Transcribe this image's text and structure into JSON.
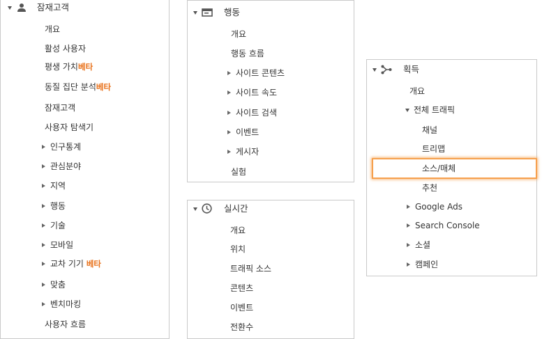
{
  "audience": {
    "title": "잠재고객",
    "icon": "person-icon",
    "items": [
      {
        "label": "개요"
      },
      {
        "label": "활성 사용자"
      },
      {
        "label": "평생 가치",
        "badge": "베타"
      },
      {
        "label": "동질 집단 분석",
        "badge": "베타"
      },
      {
        "label": "잠재고객"
      },
      {
        "label": "사용자 탐색기"
      },
      {
        "label": "인구통계"
      },
      {
        "label": "관심분야"
      },
      {
        "label": "지역"
      },
      {
        "label": "행동"
      },
      {
        "label": "기술"
      },
      {
        "label": "모바일"
      },
      {
        "label": "교차 기기",
        "badge": "베타"
      },
      {
        "label": "맞춤"
      },
      {
        "label": "벤치마킹"
      },
      {
        "label": "사용자 흐름"
      }
    ]
  },
  "behavior": {
    "title": "행동",
    "icon": "behavior-window-icon",
    "items": [
      {
        "label": "개요"
      },
      {
        "label": "행동 흐름"
      },
      {
        "label": "사이트 콘텐츠"
      },
      {
        "label": "사이트 속도"
      },
      {
        "label": "사이트 검색"
      },
      {
        "label": "이벤트"
      },
      {
        "label": "게시자"
      },
      {
        "label": "실험"
      }
    ]
  },
  "realtime": {
    "title": "실시간",
    "icon": "clock-icon",
    "items": [
      {
        "label": "개요"
      },
      {
        "label": "위치"
      },
      {
        "label": "트래픽 소스"
      },
      {
        "label": "콘텐츠"
      },
      {
        "label": "이벤트"
      },
      {
        "label": "전환수"
      }
    ]
  },
  "acquisition": {
    "title": "획득",
    "icon": "acquisition-branch-icon",
    "items": [
      {
        "label": "개요"
      },
      {
        "label": "전체 트래픽"
      },
      {
        "label": "채널"
      },
      {
        "label": "트리맵"
      },
      {
        "label": "소스/매체",
        "selected": true
      },
      {
        "label": "추천"
      },
      {
        "label": "Google Ads"
      },
      {
        "label": "Search Console"
      },
      {
        "label": "소셜"
      },
      {
        "label": "캠페인"
      }
    ]
  },
  "colors": {
    "beta": "#e8711a",
    "highlight": "#f6a04d",
    "border": "#c9c9c9"
  }
}
